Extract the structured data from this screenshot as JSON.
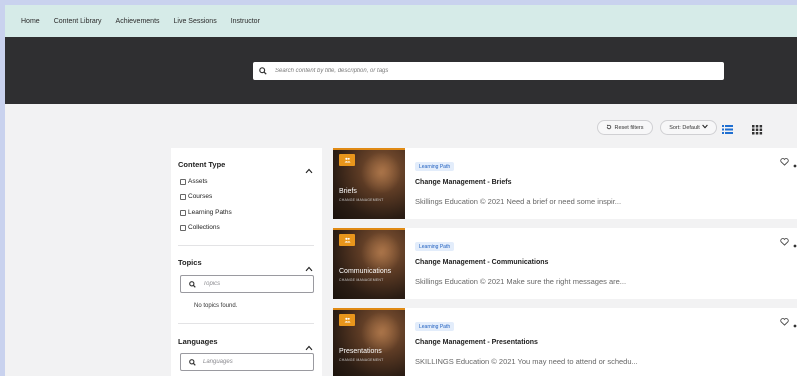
{
  "nav": {
    "items": [
      {
        "label": "Home"
      },
      {
        "label": "Content Library"
      },
      {
        "label": "Achievements"
      },
      {
        "label": "Live Sessions"
      },
      {
        "label": "Instructor"
      }
    ]
  },
  "search": {
    "placeholder": "Search content by title, description, or tags",
    "icon": "search-icon"
  },
  "toolbar": {
    "reset_label": "Reset filters",
    "sort_label": "Sort: Default",
    "list_view_icon": "list-view-icon",
    "grid_view_icon": "grid-view-icon",
    "accent": "#1f6fd1"
  },
  "filters": {
    "content_type": {
      "title": "Content Type",
      "options": [
        "Assets",
        "Courses",
        "Learning Paths",
        "Collections"
      ]
    },
    "topics": {
      "title": "Topics",
      "placeholder": "Topics",
      "empty_text": "No topics found."
    },
    "languages": {
      "title": "Languages",
      "placeholder": "Languages"
    }
  },
  "cards": [
    {
      "thumb_title": "Briefs",
      "thumb_subtitle": "CHANGE MANAGEMENT",
      "tag": "Learning Path",
      "title": "Change Management - Briefs",
      "description": "Skillings Education © 2021 Need a brief or need some inspir..."
    },
    {
      "thumb_title": "Communications",
      "thumb_subtitle": "CHANGE MANAGEMENT",
      "tag": "Learning Path",
      "title": "Change Management - Communications",
      "description": "Skillings Education © 2021 Make sure the right messages are..."
    },
    {
      "thumb_title": "Presentations",
      "thumb_subtitle": "CHANGE MANAGEMENT",
      "tag": "Learning Path",
      "title": "Change Management - Presentations",
      "description": "SKILLINGS Education © 2021 You may need to attend or schedu..."
    }
  ],
  "colors": {
    "nav_bg": "#d6ebe8",
    "search_band": "#2f2f31",
    "badge_orange": "#e8961c",
    "tag_bg": "#e3edfb",
    "tag_text": "#1f5fbf"
  }
}
